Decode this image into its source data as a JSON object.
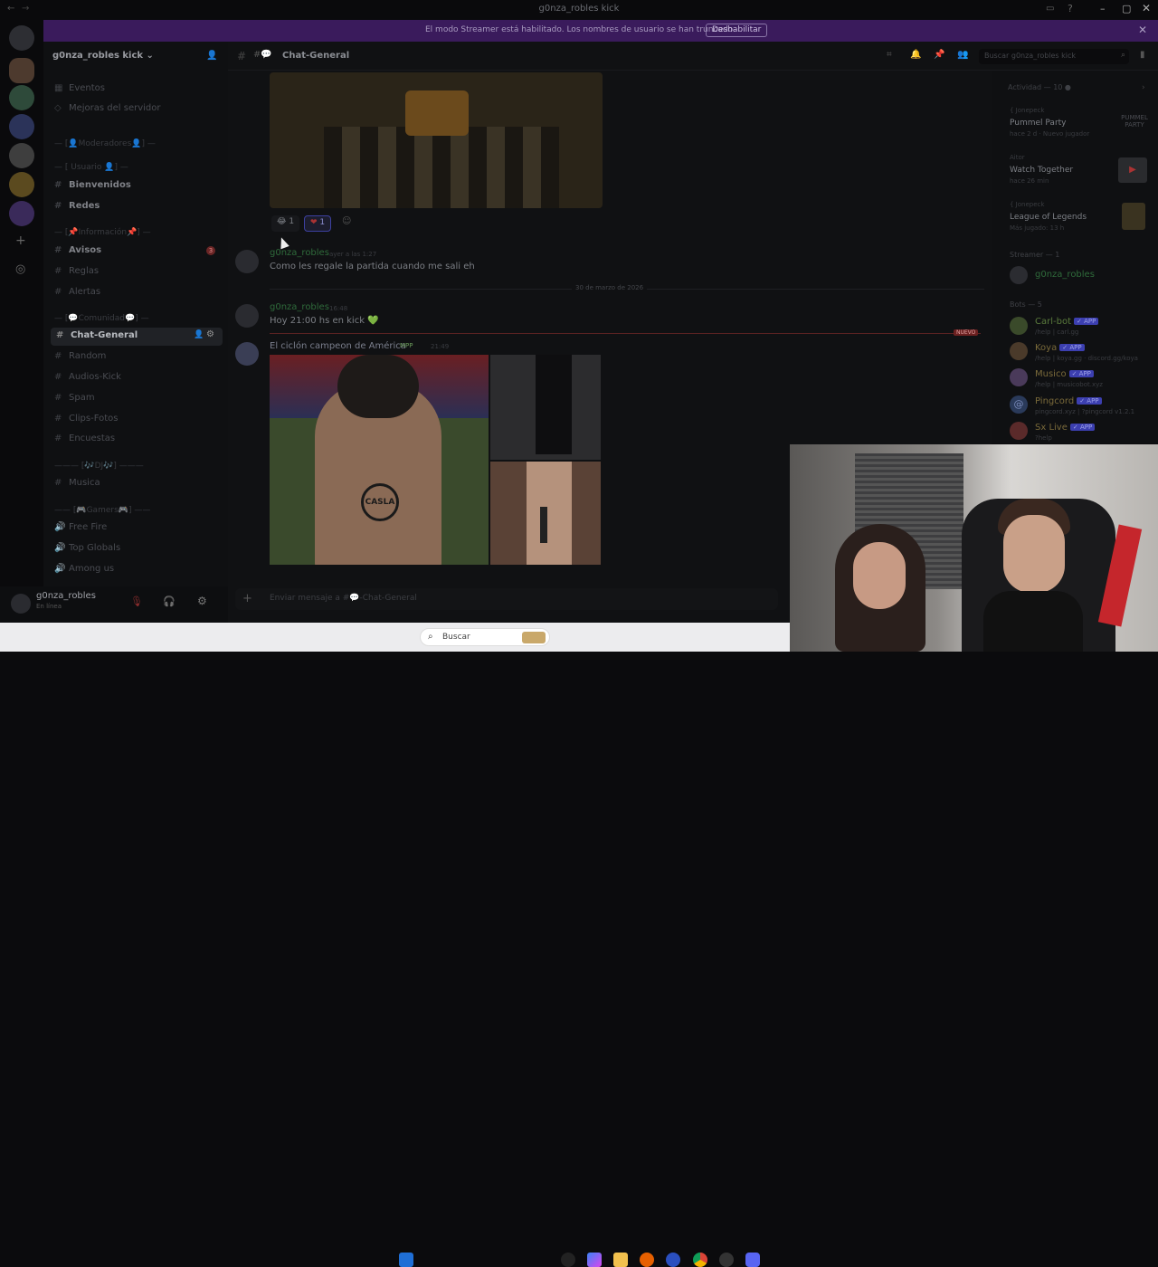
{
  "window": {
    "title": "g0nza_robles kick"
  },
  "banner": {
    "message": "El modo Streamer está habilitado. Los nombres de usuario se han truncado.",
    "button": "Deshabilitar"
  },
  "server": {
    "name": "g0nza_robles kick"
  },
  "channels": {
    "top": [
      {
        "label": "Eventos"
      },
      {
        "label": "Mejoras del servidor"
      }
    ],
    "categories": [
      {
        "label": "— [👤Moderadores👤] —"
      },
      {
        "label": "— [ Usuario 👤] —"
      },
      {
        "label": "— [📌Información📌] —"
      },
      {
        "label": "— [💬Comunidad💬] —"
      },
      {
        "label": "——— [🎶DJ🎶] ———"
      },
      {
        "label": "—— [🎮Gamers🎮] ——"
      }
    ],
    "items": [
      {
        "label": "Bienvenidos"
      },
      {
        "label": "Redes"
      },
      {
        "label": "Avisos",
        "badge": "3"
      },
      {
        "label": "Reglas"
      },
      {
        "label": "Alertas"
      },
      {
        "label": "Chat-General"
      },
      {
        "label": "Random"
      },
      {
        "label": "Audios-Kick"
      },
      {
        "label": "Spam"
      },
      {
        "label": "Clips-Fotos"
      },
      {
        "label": "Encuestas"
      },
      {
        "label": "Musica"
      },
      {
        "label": "Free Fire"
      },
      {
        "label": "Top Globals"
      },
      {
        "label": "Among us"
      }
    ]
  },
  "user": {
    "name": "g0nza_robles",
    "status": "En línea"
  },
  "chat_header": {
    "channel": "Chat-General",
    "search_placeholder": "Buscar g0nza_robles kick"
  },
  "messages": [
    {
      "author": "g0nza_robles",
      "time": "ayer a las 1:27",
      "text": "Como les regale la partida cuando me sali eh"
    },
    {
      "author": "g0nza_robles",
      "time": "16:48",
      "text": "Hoy 21:00 hs en kick 💚"
    },
    {
      "author": "El ciclón campeon de América",
      "badge": "MPP",
      "time": "21:49",
      "text": ""
    }
  ],
  "reactions": [
    {
      "emoji": "😂",
      "count": "1"
    },
    {
      "emoji": "❤",
      "count": "1"
    }
  ],
  "date_divider": "30 de marzo de 2026",
  "new_label": "NUEVO",
  "composer": {
    "placeholder": "Enviar mensaje a #💬-Chat-General"
  },
  "activity": {
    "title": "Actividad — 10",
    "items": [
      {
        "user": "{ Jonepeck",
        "game": "Pummel Party",
        "meta": "hace 2 d · Nuevo jugador",
        "logo": "PUMMEL PARTY"
      },
      {
        "user": "Aitor",
        "game": "Watch Together",
        "meta": "hace 26 min"
      },
      {
        "user": "{ Jonepeck",
        "game": "League of Legends",
        "meta": "Más jugado: 13 h"
      }
    ]
  },
  "members": {
    "streamer_header": "Streamer — 1",
    "streamer": "g0nza_robles",
    "bots_header": "Bots — 5",
    "bots": [
      {
        "name": "Carl-bot",
        "sub": "/help | carl.gg"
      },
      {
        "name": "Koya",
        "sub": "/help | koya.gg · discord.gg/koya"
      },
      {
        "name": "Musico",
        "sub": "/help | musicobot.xyz"
      },
      {
        "name": "Pingcord",
        "sub": "pingcord.xyz | ?pingcord v1.2.1"
      },
      {
        "name": "Sx Live",
        "sub": "?help"
      }
    ],
    "app_badge": "✓ APP"
  },
  "taskbar": {
    "search": "Buscar"
  },
  "image_text": {
    "logo": "CASLA"
  }
}
